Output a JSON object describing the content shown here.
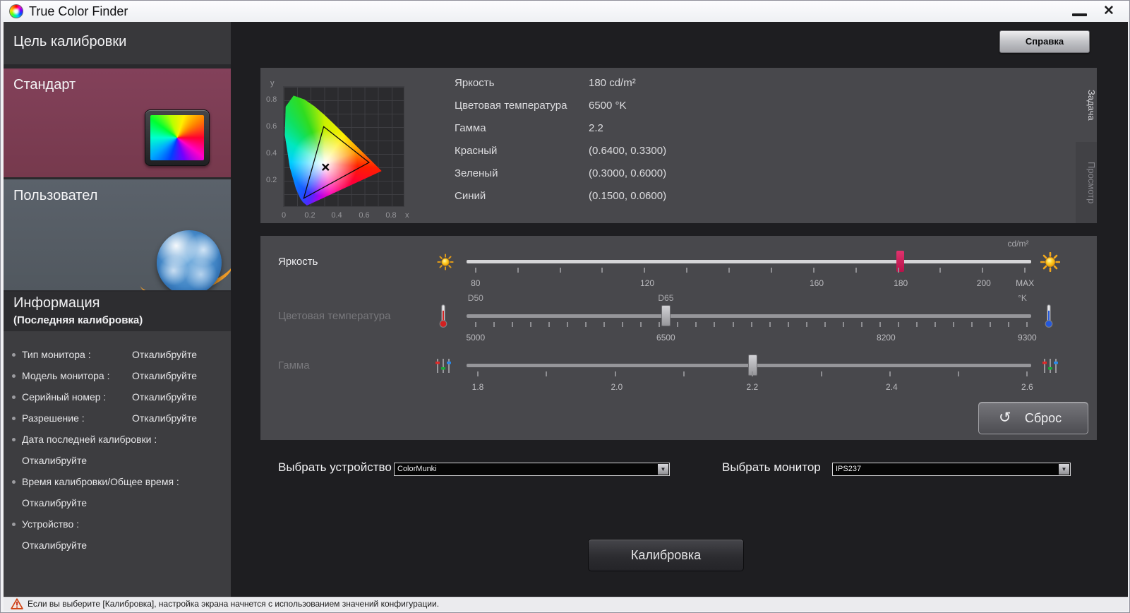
{
  "window": {
    "title": "True Color Finder"
  },
  "titlebar": {
    "close_glyph": "✕"
  },
  "icons": {
    "dropdown_arrow": "▼",
    "reset_arrow": "↺"
  },
  "sidebar": {
    "header": "Цель калибровки",
    "modes": [
      {
        "label": "Стандарт",
        "selected": true,
        "icon": "monitor-color-icon"
      },
      {
        "label": "Пользовател",
        "selected": false,
        "icon": "globe-icon"
      }
    ],
    "info_header_line1": "Информация",
    "info_header_line2": "(Последняя калибровка)",
    "info_items": [
      {
        "label": "Тип монитора :",
        "value": "Откалибруйте",
        "wrap": false
      },
      {
        "label": "Модель монитора :",
        "value": "Откалибруйте",
        "wrap": false
      },
      {
        "label": "Серийный номер :",
        "value": "Откалибруйте",
        "wrap": false
      },
      {
        "label": "Разрешение :",
        "value": "Откалибруйте",
        "wrap": false
      },
      {
        "label": "Дата последней калибровки :",
        "value": "Откалибруйте",
        "wrap": true
      },
      {
        "label": "Время калибровки/Общее время :",
        "value": "Откалибруйте",
        "wrap": true
      },
      {
        "label": "Устройство :",
        "value": "Откалибруйте",
        "wrap": true
      }
    ]
  },
  "main": {
    "help_button": "Справка",
    "tabs": [
      {
        "label": "Задача",
        "active": true
      },
      {
        "label": "Просмотр",
        "active": false
      }
    ],
    "chart": {
      "y_axis_name": "y",
      "x_axis_name": "x",
      "y_ticks": [
        "0.8",
        "0.6",
        "0.4",
        "0.2"
      ],
      "x_ticks": [
        "0",
        "0.2",
        "0.4",
        "0.6",
        "0.8"
      ]
    },
    "info_rows": [
      {
        "label": "Яркость",
        "value": "180 cd/m²"
      },
      {
        "label": "Цветовая температура",
        "value": "6500 °K"
      },
      {
        "label": "Гамма",
        "value": "2.2"
      },
      {
        "label": "Красный",
        "value": "(0.6400, 0.3300)"
      },
      {
        "label": "Зеленый",
        "value": "(0.3000, 0.6000)"
      },
      {
        "label": "Синий",
        "value": "(0.1500, 0.0600)"
      }
    ],
    "sliders": [
      {
        "id": "brightness",
        "label": "Яркость",
        "enabled": true,
        "value": "180",
        "handle_pct": 76.9,
        "handle_color": "#cb1a55",
        "ticks": {
          "count": 14,
          "start": 1.6,
          "end": 98.9
        },
        "top_labels": [
          {
            "text": "cd/m²",
            "pct": 99,
            "align": "right"
          }
        ],
        "labels": [
          {
            "text": "80",
            "pct": 1.6
          },
          {
            "text": "120",
            "pct": 32
          },
          {
            "text": "160",
            "pct": 62
          },
          {
            "text": "180",
            "pct": 76.9
          },
          {
            "text": "200",
            "pct": 91.6
          },
          {
            "text": "MAX",
            "pct": 98.9
          }
        ]
      },
      {
        "id": "temperature",
        "label": "Цветовая температура",
        "enabled": false,
        "value": "6500",
        "handle_pct": 35.3,
        "ticks": {
          "count": 31,
          "start": 1.6,
          "end": 99.3
        },
        "top_labels": [
          {
            "text": "D50",
            "pct": 1.6
          },
          {
            "text": "D65",
            "pct": 35.3
          },
          {
            "text": "°K",
            "pct": 99,
            "align": "right"
          }
        ],
        "labels": [
          {
            "text": "5000",
            "pct": 1.6
          },
          {
            "text": "6500",
            "pct": 35.3
          },
          {
            "text": "8200",
            "pct": 74.3
          },
          {
            "text": "9300",
            "pct": 99.3
          }
        ]
      },
      {
        "id": "gamma",
        "label": "Гамма",
        "enabled": false,
        "value": "2.2",
        "handle_pct": 50.6,
        "ticks": {
          "count": 9,
          "start": 2,
          "end": 99.3
        },
        "top_labels": [],
        "labels": [
          {
            "text": "1.8",
            "pct": 2
          },
          {
            "text": "2.0",
            "pct": 26.6
          },
          {
            "text": "2.2",
            "pct": 50.6
          },
          {
            "text": "2.4",
            "pct": 75.3
          },
          {
            "text": "2.6",
            "pct": 99.3
          }
        ]
      }
    ],
    "reset_button": "Сброс",
    "device_select": {
      "label": "Выбрать устройство",
      "value": "ColorMunki"
    },
    "monitor_select": {
      "label": "Выбрать монитор",
      "value": "IPS237"
    },
    "calibrate_button": "Калибровка"
  },
  "statusbar": {
    "message": "Если вы выберите [Калибровка], настройка экрана начнется с использованием значений конфигурации."
  },
  "chart_data": {
    "type": "scatter",
    "title": "CIE 1931 xy chromaticity diagram with sRGB gamut triangle",
    "xlabel": "x",
    "ylabel": "y",
    "xlim": [
      0,
      0.9
    ],
    "ylim": [
      0,
      0.9
    ],
    "grid": true,
    "gamut_triangle": {
      "red": [
        0.64,
        0.33
      ],
      "green": [
        0.3,
        0.6
      ],
      "blue": [
        0.15,
        0.06
      ]
    },
    "white_point": [
      0.31,
      0.3
    ]
  }
}
